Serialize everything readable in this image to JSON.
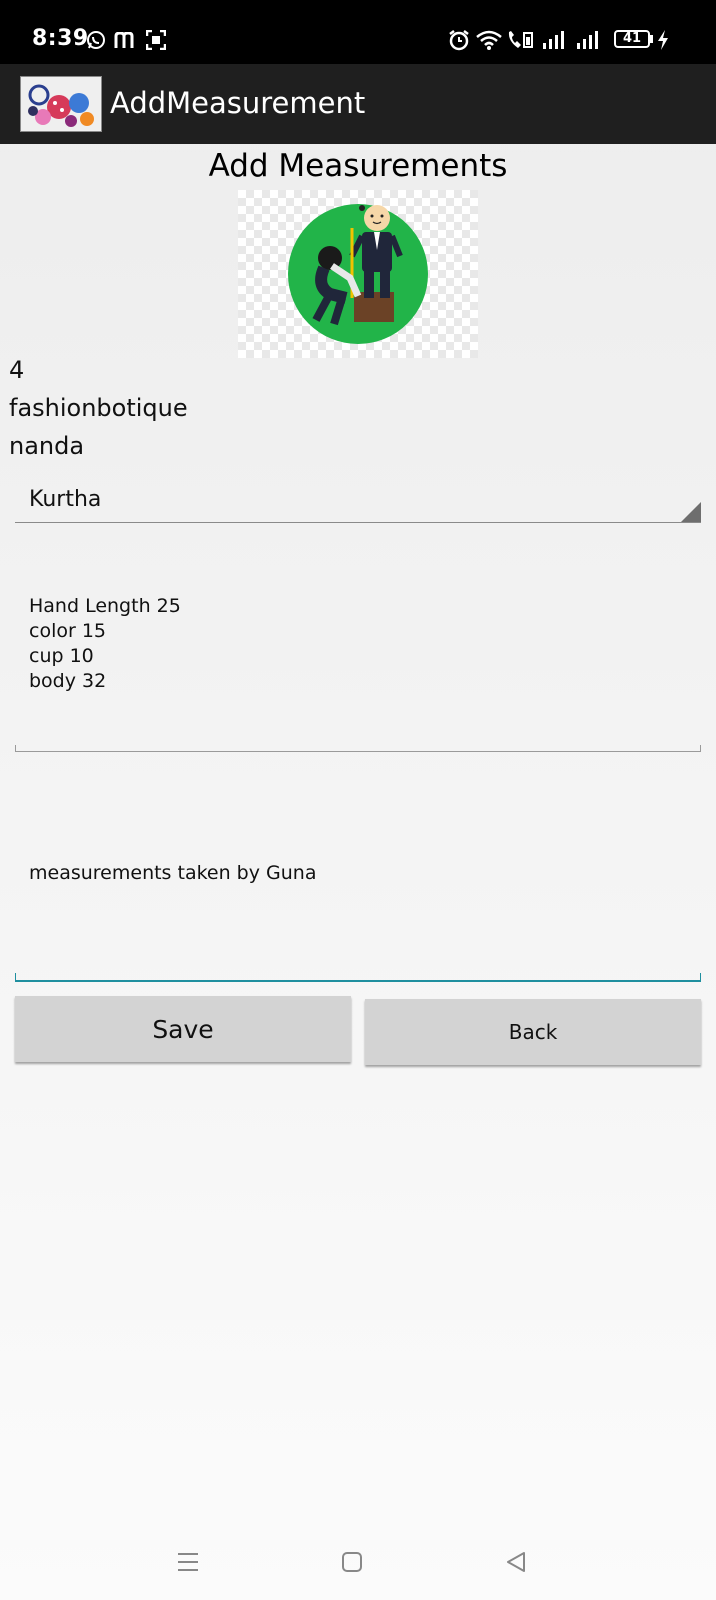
{
  "status_bar": {
    "time": "8:39",
    "battery_level": "41",
    "icons": [
      "whatsapp-icon",
      "m-app-icon",
      "scan-icon",
      "alarm-icon",
      "wifi-icon",
      "volte-call-icon",
      "signal-icon",
      "signal-icon-2",
      "battery-icon",
      "charging-icon"
    ]
  },
  "app_bar": {
    "title": "AddMeasurement",
    "logo": "boutique-logo"
  },
  "page": {
    "heading": "Add Measurements",
    "illustration": "tailor-measuring-illustration",
    "info_lines": [
      "4",
      "fashionbotique",
      "nanda"
    ]
  },
  "form": {
    "garment_type": {
      "selected": "Kurtha"
    },
    "measurements_text": "Hand Length 25\ncolor 15\ncup 10\nbody 32",
    "notes_text": "measurements taken by Guna"
  },
  "buttons": {
    "save_label": "Save",
    "back_label": "Back"
  },
  "nav_bar": {
    "icons": [
      "menu-icon",
      "home-icon",
      "back-icon"
    ]
  },
  "colors": {
    "status_bar_bg": "#000000",
    "app_bar_bg": "#1f1f1f",
    "button_bg": "#d3d3d3",
    "focused_field_accent": "#1f8f9f",
    "illustration_circle": "#22b449"
  }
}
